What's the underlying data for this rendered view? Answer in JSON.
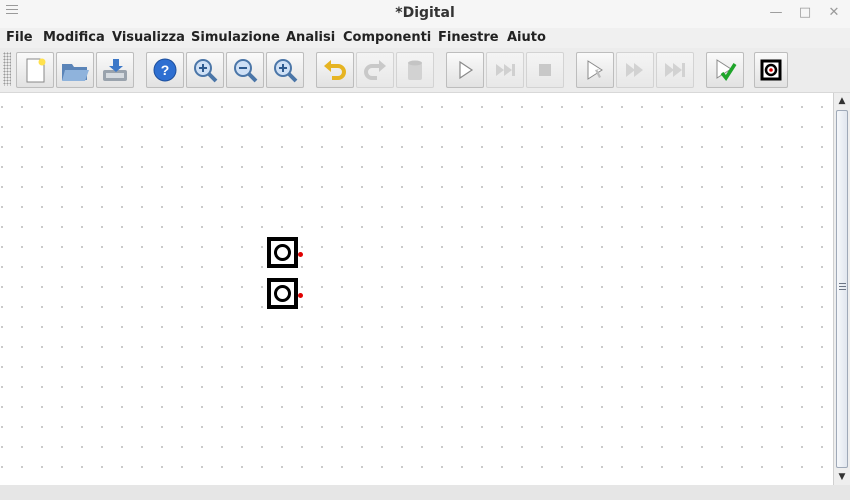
{
  "window": {
    "title": "*Digital"
  },
  "menu": [
    "File",
    "Modifica",
    "Visualizza",
    "Simulazione",
    "Analisi",
    "Componenti",
    "Finestre",
    "Aiuto"
  ],
  "toolbar": {
    "buttons": [
      {
        "name": "new-file-button",
        "icon": "new-document-icon",
        "enabled": true
      },
      {
        "name": "open-file-button",
        "icon": "folder-open-icon",
        "enabled": true
      },
      {
        "name": "save-file-button",
        "icon": "save-icon",
        "enabled": true
      },
      {
        "name": "help-button",
        "icon": "help-icon",
        "enabled": true
      },
      {
        "name": "zoom-fit-button",
        "icon": "zoom-in-icon",
        "enabled": true
      },
      {
        "name": "zoom-out-button",
        "icon": "zoom-out-icon",
        "enabled": true
      },
      {
        "name": "zoom-in-button",
        "icon": "zoom-plus-icon",
        "enabled": true
      },
      {
        "name": "undo-button",
        "icon": "undo-icon",
        "enabled": true
      },
      {
        "name": "redo-button",
        "icon": "redo-icon",
        "enabled": false
      },
      {
        "name": "delete-button",
        "icon": "trash-icon",
        "enabled": false
      },
      {
        "name": "start-simulation-button",
        "icon": "play-icon",
        "enabled": true
      },
      {
        "name": "step-simulation-button",
        "icon": "step-forward-icon",
        "enabled": false
      },
      {
        "name": "stop-simulation-button",
        "icon": "stop-icon",
        "enabled": false
      },
      {
        "name": "micro-step-button",
        "icon": "cursor-step-icon",
        "enabled": true
      },
      {
        "name": "run-to-break-button",
        "icon": "fast-forward-icon",
        "enabled": false
      },
      {
        "name": "run-to-end-button",
        "icon": "skip-forward-icon",
        "enabled": false
      },
      {
        "name": "analyze-button",
        "icon": "check-icon",
        "enabled": true
      },
      {
        "name": "test-case-button",
        "icon": "target-icon",
        "enabled": true
      }
    ]
  },
  "canvas": {
    "components": [
      {
        "name": "input-component-1",
        "icon": "input-terminal-icon"
      },
      {
        "name": "input-component-2",
        "icon": "input-terminal-icon"
      }
    ]
  }
}
